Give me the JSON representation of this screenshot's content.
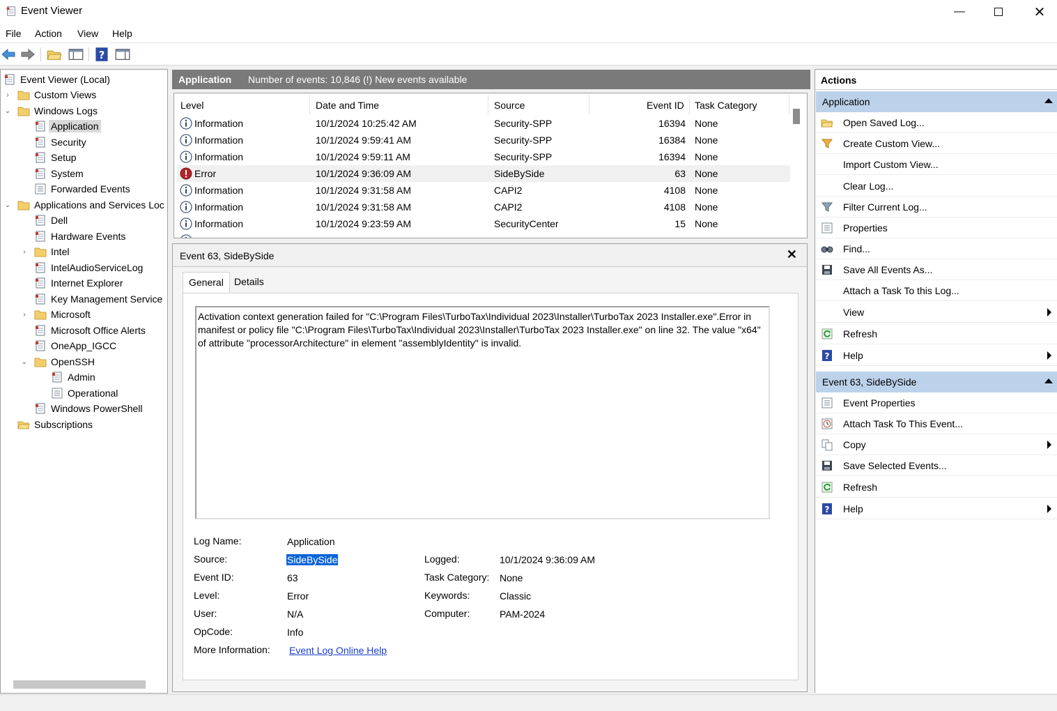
{
  "window": {
    "title": "Event Viewer"
  },
  "menu": [
    "File",
    "Action",
    "View",
    "Help"
  ],
  "tree": {
    "root": "Event Viewer (Local)",
    "custom_views": "Custom Views",
    "windows_logs": "Windows Logs",
    "application": "Application",
    "security": "Security",
    "setup": "Setup",
    "system": "System",
    "forwarded": "Forwarded Events",
    "apps_services": "Applications and Services Loc",
    "dell": "Dell",
    "hardware": "Hardware Events",
    "intel": "Intel",
    "intel_audio": "IntelAudioServiceLog",
    "ie": "Internet Explorer",
    "kms": "Key Management Service",
    "microsoft": "Microsoft",
    "office_alerts": "Microsoft Office Alerts",
    "oneapp": "OneApp_IGCC",
    "openssh": "OpenSSH",
    "admin": "Admin",
    "operational": "Operational",
    "powershell": "Windows PowerShell",
    "subscriptions": "Subscriptions"
  },
  "center": {
    "log_name": "Application",
    "summary": "Number of events: 10,846 (!) New events available"
  },
  "events": {
    "columns": [
      "Level",
      "Date and Time",
      "Source",
      "Event ID",
      "Task Category"
    ],
    "rows": [
      {
        "level": "Information",
        "date": "10/1/2024 10:25:42 AM",
        "source": "Security-SPP",
        "id": "16394",
        "cat": "None"
      },
      {
        "level": "Information",
        "date": "10/1/2024 9:59:41 AM",
        "source": "Security-SPP",
        "id": "16384",
        "cat": "None"
      },
      {
        "level": "Information",
        "date": "10/1/2024 9:59:11 AM",
        "source": "Security-SPP",
        "id": "16394",
        "cat": "None"
      },
      {
        "level": "Error",
        "date": "10/1/2024 9:36:09 AM",
        "source": "SideBySide",
        "id": "63",
        "cat": "None"
      },
      {
        "level": "Information",
        "date": "10/1/2024 9:31:58 AM",
        "source": "CAPI2",
        "id": "4108",
        "cat": "None"
      },
      {
        "level": "Information",
        "date": "10/1/2024 9:31:58 AM",
        "source": "CAPI2",
        "id": "4108",
        "cat": "None"
      },
      {
        "level": "Information",
        "date": "10/1/2024 9:23:59 AM",
        "source": "SecurityCenter",
        "id": "15",
        "cat": "None"
      }
    ]
  },
  "detail": {
    "title": "Event 63, SideBySide",
    "tabs": [
      "General",
      "Details"
    ],
    "description": "Activation context generation failed for \"C:\\Program Files\\TurboTax\\Individual 2023\\Installer\\TurboTax 2023 Installer.exe\".Error in manifest or policy file \"C:\\Program Files\\TurboTax\\Individual 2023\\Installer\\TurboTax 2023 Installer.exe\" on line 32. The value \"x64\" of attribute \"processorArchitecture\" in element \"assemblyIdentity\" is invalid.",
    "labels": {
      "log_name": "Log Name:",
      "source": "Source:",
      "event_id": "Event ID:",
      "level": "Level:",
      "user": "User:",
      "opcode": "OpCode:",
      "more_info": "More Information:",
      "logged": "Logged:",
      "task_category": "Task Category:",
      "keywords": "Keywords:",
      "computer": "Computer:"
    },
    "values": {
      "log_name": "Application",
      "source": "SideBySide",
      "event_id": "63",
      "level": "Error",
      "user": "N/A",
      "opcode": "Info",
      "more_info": "Event Log Online Help",
      "logged": "10/1/2024 9:36:09 AM",
      "task_category": "None",
      "keywords": "Classic",
      "computer": "PAM-2024"
    }
  },
  "actions": {
    "title": "Actions",
    "section1": "Application",
    "items1": [
      "Open Saved Log...",
      "Create Custom View...",
      "Import Custom View...",
      "Clear Log...",
      "Filter Current Log...",
      "Properties",
      "Find...",
      "Save All Events As...",
      "Attach a Task To this Log...",
      "View",
      "Refresh",
      "Help"
    ],
    "section2": "Event 63, SideBySide",
    "items2": [
      "Event Properties",
      "Attach Task To This Event...",
      "Copy",
      "Save Selected Events...",
      "Refresh",
      "Help"
    ]
  },
  "colors": {
    "section_header": "#bcd2ea",
    "center_header": "#7a7a7a",
    "link": "#1a3fc6",
    "selection": "#0a64d8"
  }
}
